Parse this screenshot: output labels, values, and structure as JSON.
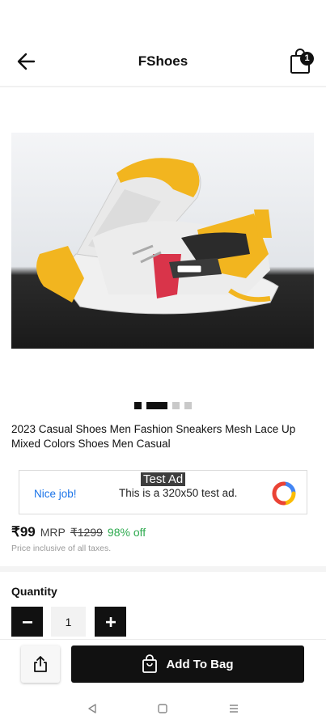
{
  "header": {
    "title": "FShoes",
    "back_icon": "arrow-left-icon",
    "cart_icon": "shopping-bag-icon",
    "cart_count": "1"
  },
  "gallery": {
    "image_icon": "sneaker-photo",
    "slides": 4,
    "active_slide": 2
  },
  "product": {
    "title": "2023 Casual Shoes Men Fashion Sneakers Mesh Lace Up Mixed Colors Shoes Men Casual",
    "price": "₹99",
    "mrp_label": "MRP",
    "mrp_value": "₹1299",
    "discount": "98% off",
    "tax_note": "Price inclusive of all taxes."
  },
  "ad": {
    "tag": "Test Ad",
    "nice": "Nice job!",
    "text": "This is a 320x50 test ad.",
    "logo_icon": "ad-logo-icon"
  },
  "quantity": {
    "label": "Quantity",
    "minus": "−",
    "value": "1",
    "plus": "+"
  },
  "actions": {
    "share_icon": "share-icon",
    "add_to_bag": "Add To Bag",
    "bag_icon": "bag-icon"
  },
  "navbar": {
    "back": "nav-back-icon",
    "home": "nav-home-icon",
    "recents": "nav-recents-icon"
  },
  "colors": {
    "primary": "#111111",
    "discount": "#2eaa4f",
    "ad_link": "#1a73e8"
  }
}
